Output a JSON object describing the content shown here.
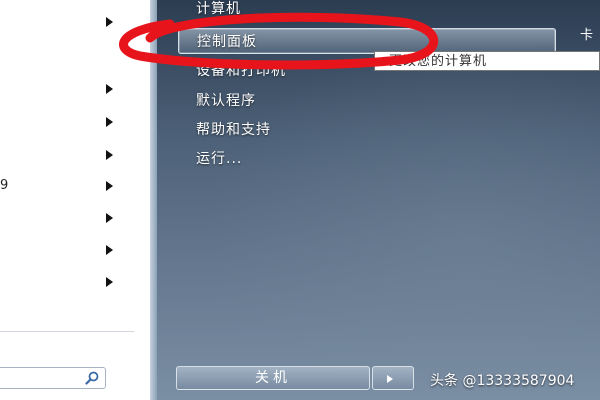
{
  "left_pane": {
    "partial_item_text": "9",
    "arrow_count": 9
  },
  "start_menu": {
    "items": [
      {
        "label": "计算机"
      },
      {
        "label": "控制面板"
      },
      {
        "label": "设备和打印机"
      },
      {
        "label": "默认程序"
      },
      {
        "label": "帮助和支持"
      },
      {
        "label": "运行..."
      }
    ],
    "tooltip": "更改您的计算机",
    "shutdown_label": "关机",
    "edge_char": "卡"
  },
  "watermark": "头条 @13333587904",
  "colors": {
    "menu_text": "#ffffff",
    "annotation_red": "#e8141b",
    "right_pane_top": "#2c3d52",
    "right_pane_bottom": "#7a8ea4"
  }
}
